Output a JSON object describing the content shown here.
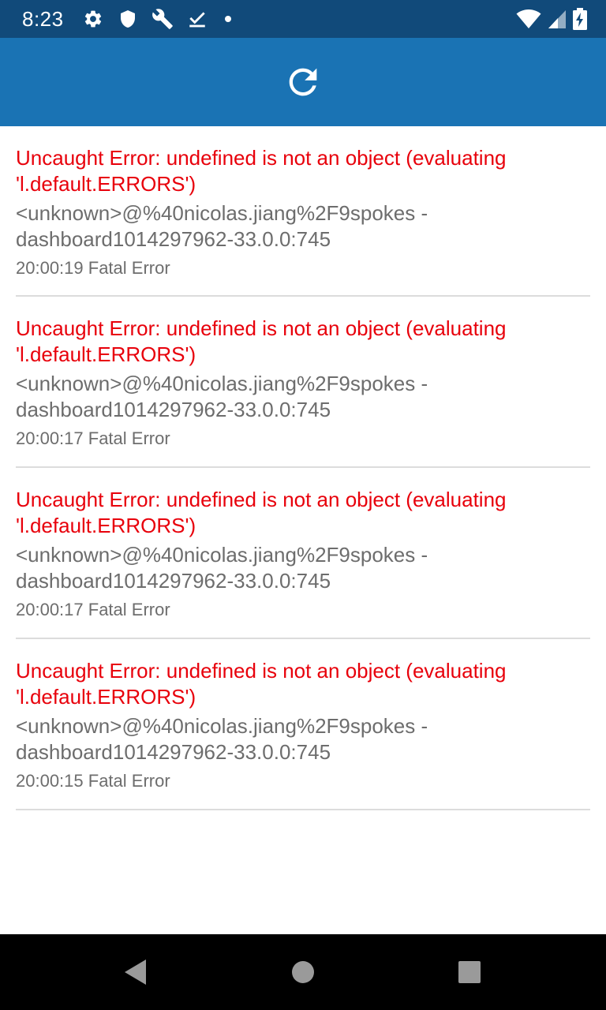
{
  "status_bar": {
    "time": "8:23",
    "background": "#114a7a",
    "left_icons": [
      "gear-icon",
      "shield-icon",
      "wrench-icon",
      "download-check-icon",
      "dot-icon"
    ],
    "right_icons": [
      "wifi-icon",
      "signal-icon",
      "battery-charging-icon"
    ]
  },
  "app_bar": {
    "background": "#1a73b4",
    "reload_icon": "reload-icon"
  },
  "errors": [
    {
      "message": "Uncaught Error: undefined is not an object (evaluating 'l.default.ERRORS')",
      "stack": "<unknown>@%40nicolas.jiang%2F9spokes -dashboard1014297962-33.0.0:745",
      "meta": "20:00:19 Fatal Error"
    },
    {
      "message": "Uncaught Error: undefined is not an object (evaluating 'l.default.ERRORS')",
      "stack": "<unknown>@%40nicolas.jiang%2F9spokes -dashboard1014297962-33.0.0:745",
      "meta": "20:00:17 Fatal Error"
    },
    {
      "message": "Uncaught Error: undefined is not an object (evaluating 'l.default.ERRORS')",
      "stack": "<unknown>@%40nicolas.jiang%2F9spokes -dashboard1014297962-33.0.0:745",
      "meta": "20:00:17 Fatal Error"
    },
    {
      "message": "Uncaught Error: undefined is not an object (evaluating 'l.default.ERRORS')",
      "stack": "<unknown>@%40nicolas.jiang%2F9spokes -dashboard1014297962-33.0.0:745",
      "meta": "20:00:15 Fatal Error"
    }
  ],
  "colors": {
    "error_red": "#e8000b",
    "secondary_text": "#6d6d6d",
    "divider": "#dcdcdc"
  },
  "nav_bar": {
    "buttons": [
      "back-icon",
      "home-icon",
      "recents-icon"
    ]
  }
}
